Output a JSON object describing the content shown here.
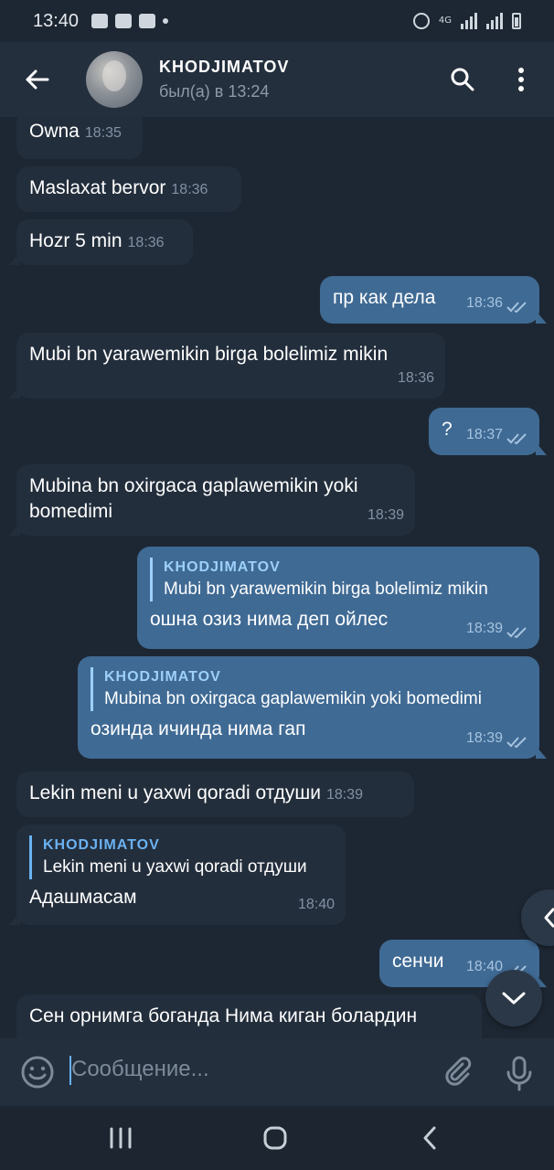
{
  "status_bar": {
    "time": "13:40",
    "network": "4G"
  },
  "header": {
    "title": "KHODJIMATOV",
    "status": "был(а) в 13:24",
    "icons": [
      "back-arrow-icon",
      "search-icon",
      "more-vert-icon"
    ]
  },
  "messages": [
    {
      "dir": "in",
      "text": "Owna",
      "time": "18:35"
    },
    {
      "dir": "in",
      "text": "Maslaxat bervor",
      "time": "18:36"
    },
    {
      "dir": "in",
      "text": "Hozr 5 min",
      "time": "18:36"
    },
    {
      "dir": "out",
      "text": "пр как дела",
      "time": "18:36",
      "read": true
    },
    {
      "dir": "in",
      "text": "Mubi bn yarawemikin birga bolelimiz mikin",
      "time": "18:36"
    },
    {
      "dir": "out",
      "text": "?",
      "time": "18:37",
      "read": true
    },
    {
      "dir": "in",
      "text_lines": [
        "Mubina bn oxirgaca gaplawemikin yoki",
        "bomedimi"
      ],
      "time": "18:39"
    },
    {
      "dir": "out",
      "reply_name": "KHODJIMATOV",
      "reply_text": "Mubi bn yarawemikin birga bolelimiz mikin",
      "text": "ошна озиз нима деп ойлес",
      "time": "18:39",
      "read": true
    },
    {
      "dir": "out",
      "reply_name": "KHODJIMATOV",
      "reply_text": "Mubina bn oxirgaca gaplawemikin yoki bomedimi",
      "text": "озинда ичинда нима гап",
      "time": "18:39",
      "read": true
    },
    {
      "dir": "in",
      "text": "Lekin meni u yaxwi qoradi отдуши",
      "time": "18:39"
    },
    {
      "dir": "in",
      "reply_name": "KHODJIMATOV",
      "reply_text": "Lekin meni u yaxwi qoradi отдуши",
      "text": "Адашмасам",
      "time": "18:40"
    },
    {
      "dir": "out",
      "text": "сенчи",
      "time": "18:40",
      "read": true
    },
    {
      "dir": "in",
      "text": "Сен орнимга боганда Нима киган болардин"
    }
  ],
  "composer": {
    "placeholder": "Сообщение..."
  },
  "colors": {
    "background": "#1d2733",
    "header": "#242f3d",
    "incoming": "#232e3c",
    "outgoing": "#3f6a94",
    "accent": "#6ab2f2"
  }
}
